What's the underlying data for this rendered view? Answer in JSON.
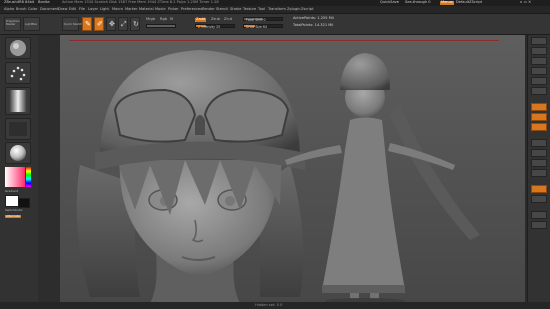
{
  "titlebar": {
    "app": "ZBrush4R6 64bit",
    "title": "Bonita",
    "stats": "Active Mem 1534  Scratch Disk 1587  Free Mem 1944  ZTime 8.2 Polys 1.25M  Timer 1.28",
    "right_items": [
      "QuickSave",
      "See-through 0",
      "Menus",
      "DefaultZScript"
    ]
  },
  "menubar": {
    "items": [
      "Alpha",
      "Brush",
      "Color",
      "Document",
      "Draw",
      "Edit",
      "File",
      "Layer",
      "Light",
      "Macro",
      "Marker",
      "Material",
      "Movie",
      "Picker",
      "Preferences",
      "Render",
      "Stencil",
      "Stroke",
      "Texture",
      "Tool",
      "Transform",
      "Zplugin",
      "Zscript"
    ]
  },
  "toolbar": {
    "projection_label": "Projection Master",
    "lightbox_label": "LightBox",
    "quicksketch_label": "Quick Sketch",
    "edit_label": "Edit",
    "draw_label": "Draw",
    "move_label": "Move",
    "scale_label": "Scale",
    "rotate_label": "Rotate",
    "mrgb_label": "Mrgb",
    "rgb_label": "Rgb",
    "m_label": "M",
    "zadd_label": "Zadd",
    "zsub_label": "Zsub",
    "zcut_label": "Zcut",
    "focal_label": "Focal Shift 0",
    "drawsize_label": "Draw Size 64",
    "rgbintensity_label": "Rgb Intensity 100",
    "zintensity_label": "Z Intensity 25",
    "activepoints_label": "ActivePoints: 1.255 Mil",
    "totalpoints_label": "TotalPoints: 14.321 Mil"
  },
  "left_shelf": {
    "gradient_label": "Gradient",
    "switchcolor_label": "SwitchColor",
    "alternate_label": "Alternate"
  },
  "status": {
    "text": "Hidden set: 0 0"
  },
  "colors": {
    "accent": "#d9771f",
    "panel": "#353535",
    "background": "#2b2b2b"
  },
  "icons": [
    "standard-brush-icon",
    "dots-stroke-icon",
    "alpha-icon",
    "texture-icon",
    "material-sphere-icon",
    "color-picker-icon"
  ]
}
